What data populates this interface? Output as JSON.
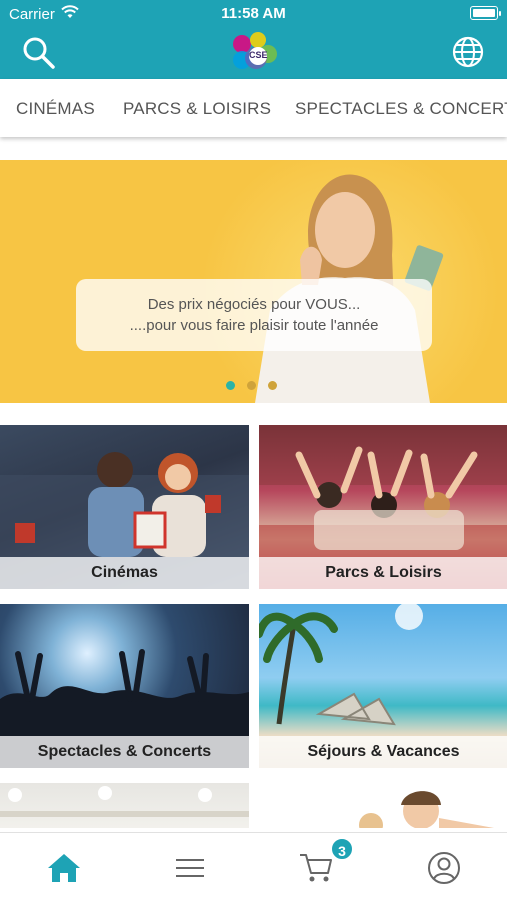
{
  "status_bar": {
    "carrier": "Carrier",
    "time": "11:58 AM"
  },
  "header": {
    "logo_text": "CSE",
    "search_icon": "search-icon",
    "language_icon": "globe-icon",
    "color": "#1ea3b5"
  },
  "tabs": [
    {
      "label": "CINÉMAS"
    },
    {
      "label": "PARCS & LOISIRS"
    },
    {
      "label": "SPECTACLES & CONCERTS"
    }
  ],
  "banner": {
    "line1": "Des prix négociés pour VOUS...",
    "line2": "....pour vous faire plaisir toute l'année",
    "slide_count": 3,
    "active_slide": 1
  },
  "categories": [
    {
      "label": "Cinémas"
    },
    {
      "label": "Parcs & Loisirs"
    },
    {
      "label": "Spectacles & Concerts"
    },
    {
      "label": "Séjours & Vacances"
    }
  ],
  "bottom_nav": {
    "items": [
      "home-icon",
      "menu-icon",
      "cart-icon",
      "profile-icon"
    ],
    "cart_badge": "3",
    "active_color": "#1ea3b5"
  }
}
